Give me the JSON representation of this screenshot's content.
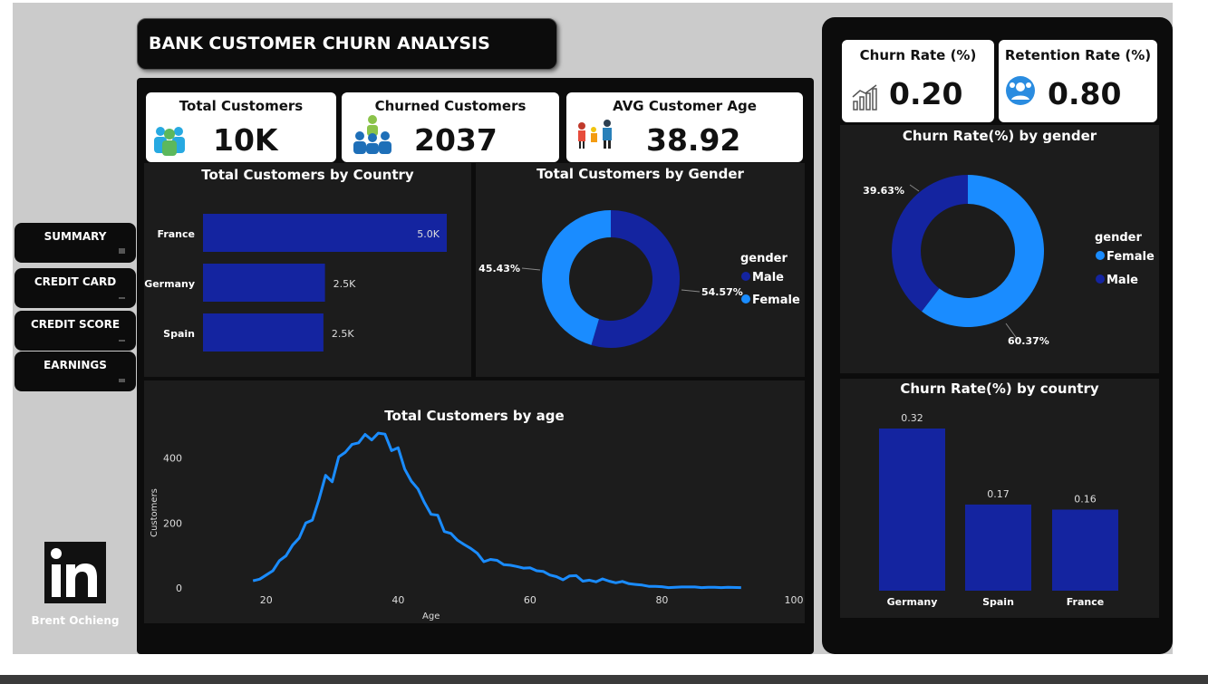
{
  "title": "BANK CUSTOMER CHURN ANALYSIS",
  "nav": [
    {
      "label": "SUMMARY"
    },
    {
      "label": "CREDIT CARD"
    },
    {
      "label": "CREDIT SCORE"
    },
    {
      "label": "EARNINGS"
    }
  ],
  "author": "Brent Ochieng",
  "kpis": {
    "total_customers": {
      "label": "Total Customers",
      "value": "10K"
    },
    "churned_customers": {
      "label": "Churned Customers",
      "value": "2037"
    },
    "avg_age": {
      "label": "AVG Customer Age",
      "value": "38.92"
    },
    "churn_rate": {
      "label": "Churn Rate (%)",
      "value": "0.20"
    },
    "retention_rate": {
      "label": "Retention Rate (%)",
      "value": "0.80"
    }
  },
  "colors": {
    "dark_blue": "#1424a0",
    "light_blue": "#1a8cff",
    "line": "#1a8cff"
  },
  "chart_data": [
    {
      "type": "bar",
      "title": "Total Customers by Country",
      "orientation": "horizontal",
      "categories": [
        "France",
        "Germany",
        "Spain"
      ],
      "values": [
        5014,
        2509,
        2477
      ],
      "labels": [
        "5.0K",
        "2.5K",
        "2.5K"
      ]
    },
    {
      "type": "pie",
      "title": "Total Customers by Gender",
      "legend_title": "gender",
      "legend_position": "right",
      "categories": [
        "Male",
        "Female"
      ],
      "values": [
        54.57,
        45.43
      ],
      "labels": [
        "54.57%",
        "45.43%"
      ]
    },
    {
      "type": "line",
      "title": "Total Customers by age",
      "xlabel": "Age",
      "ylabel": "Customers",
      "xlim": [
        10,
        100
      ],
      "ylim": [
        0,
        480
      ],
      "xticks": [
        "20",
        "40",
        "60",
        "80",
        "100"
      ],
      "yticks": [
        "0",
        "200",
        "400"
      ],
      "x": [
        18,
        19,
        20,
        21,
        22,
        23,
        24,
        25,
        26,
        27,
        28,
        29,
        30,
        31,
        32,
        33,
        34,
        35,
        36,
        37,
        38,
        39,
        40,
        41,
        42,
        43,
        44,
        45,
        46,
        47,
        48,
        49,
        50,
        51,
        52,
        53,
        54,
        55,
        56,
        57,
        58,
        59,
        60,
        61,
        62,
        63,
        64,
        65,
        66,
        67,
        68,
        69,
        70,
        71,
        72,
        73,
        74,
        75,
        76,
        77,
        78,
        79,
        80,
        81,
        82,
        83,
        84,
        85,
        86,
        87,
        88,
        89,
        90,
        92
      ],
      "values": [
        22,
        27,
        40,
        53,
        84,
        99,
        132,
        154,
        200,
        209,
        273,
        347,
        327,
        404,
        418,
        442,
        447,
        473,
        456,
        477,
        474,
        423,
        432,
        366,
        329,
        305,
        263,
        227,
        224,
        174,
        168,
        147,
        134,
        122,
        107,
        81,
        88,
        85,
        72,
        70,
        66,
        61,
        62,
        53,
        51,
        40,
        35,
        25,
        37,
        38,
        21,
        24,
        19,
        28,
        21,
        16,
        20,
        13,
        11,
        9,
        5,
        5,
        4,
        1,
        2,
        3,
        3,
        3,
        1,
        2,
        2,
        1,
        2,
        1
      ]
    },
    {
      "type": "pie",
      "title": "Churn Rate(%) by gender",
      "legend_title": "gender",
      "legend_position": "right",
      "categories": [
        "Female",
        "Male"
      ],
      "values": [
        60.37,
        39.63
      ],
      "labels": [
        "60.37%",
        "39.63%"
      ]
    },
    {
      "type": "bar",
      "title": "Churn Rate(%) by country",
      "categories": [
        "Germany",
        "Spain",
        "France"
      ],
      "values": [
        0.32,
        0.17,
        0.16
      ],
      "labels": [
        "0.32",
        "0.17",
        "0.16"
      ]
    }
  ]
}
